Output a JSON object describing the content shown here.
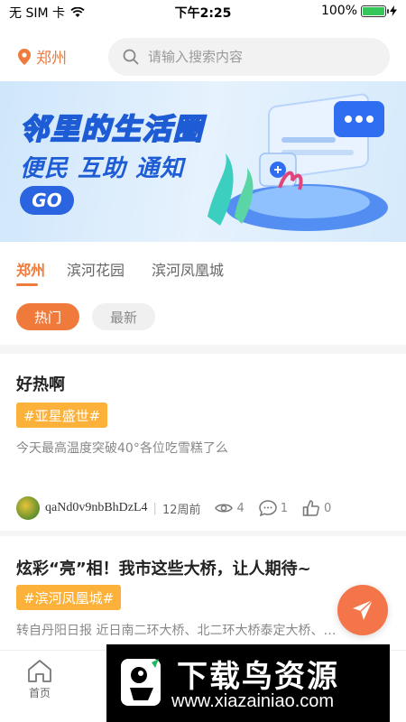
{
  "status_bar": {
    "carrier": "无 SIM 卡",
    "time": "下午2:25",
    "battery": "100%",
    "battery_level": 1.0
  },
  "header": {
    "location": "郑州",
    "search_placeholder": "请输入搜索内容"
  },
  "banner": {
    "title": "邻里的生活圈",
    "subtitle": "便民 互助 通知",
    "button": "GO"
  },
  "region_tabs": [
    {
      "label": "郑州",
      "active": true
    },
    {
      "label": "滨河花园",
      "active": false
    },
    {
      "label": "滨河凤凰城",
      "active": false
    }
  ],
  "sort_tabs": [
    {
      "label": "热门",
      "active": true
    },
    {
      "label": "最新",
      "active": false
    }
  ],
  "posts": [
    {
      "title": "好热啊",
      "tag": "#亚星盛世#",
      "excerpt": "今天最高温度突破40°各位吃雪糕了么",
      "author": "qaNd0v9nbBhDzL4",
      "time": "12周前",
      "views": "4",
      "comments": "1",
      "likes": "0"
    },
    {
      "title": "炫彩“亮”相！我市这些大桥，让人期待~",
      "tag": "#滨河凤凰城#",
      "excerpt": "转自丹阳日报 近日南二环大桥、北二环大桥泰定大桥、…"
    }
  ],
  "bottom_nav": {
    "home": "首页"
  },
  "watermark": {
    "text": "下载鸟资源",
    "url": "www.xiazainiao.com"
  },
  "colors": {
    "accent": "#f07a3c",
    "tag": "#fcb23a",
    "fab": "#f5754a"
  }
}
